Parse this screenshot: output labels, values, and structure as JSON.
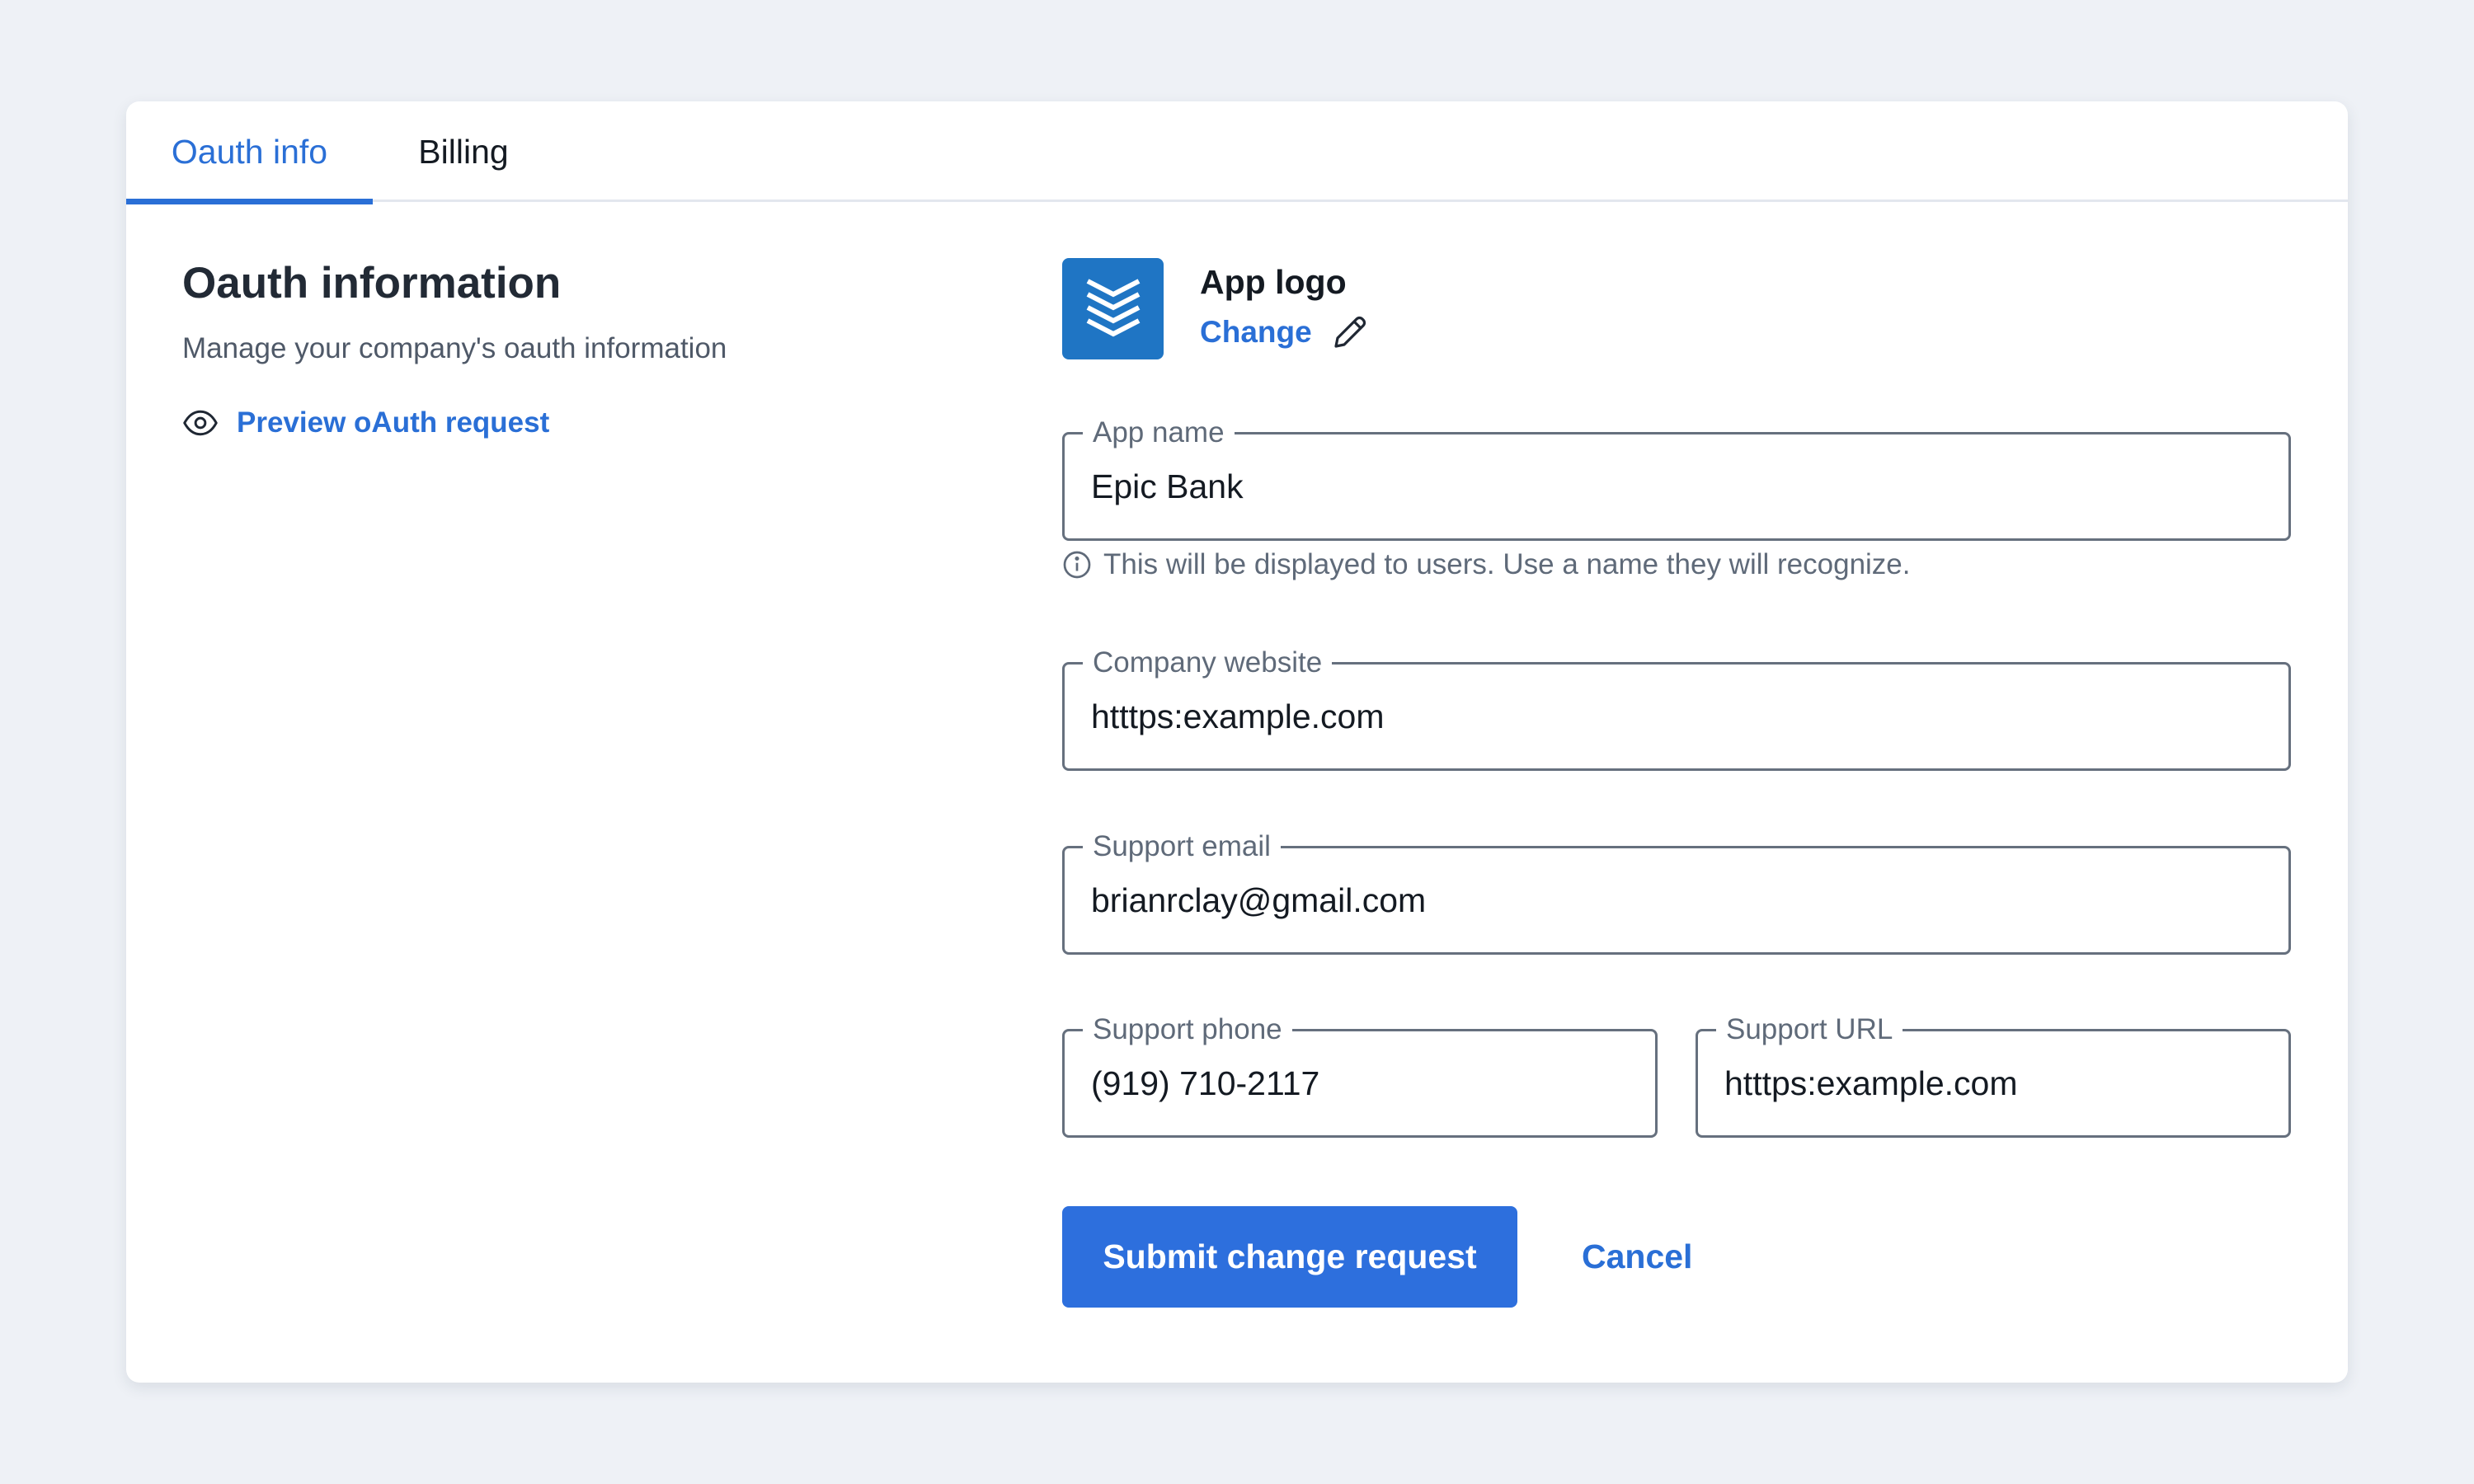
{
  "tabs": [
    {
      "label": "Oauth info",
      "active": true
    },
    {
      "label": "Billing",
      "active": false
    }
  ],
  "section": {
    "title": "Oauth information",
    "description": "Manage your company's oauth information",
    "preview_link": "Preview oAuth request",
    "preview_icon": "eye-icon"
  },
  "app_logo": {
    "label": "App logo",
    "change_label": "Change",
    "change_icon": "pencil-icon",
    "logo_icon": "chevron-stack-logo",
    "logo_color": "#1f75c4"
  },
  "form": {
    "app_name": {
      "label": "App name",
      "value": "Epic Bank",
      "hint": "This will be displayed to users. Use a name they will recognize.",
      "hint_icon": "info-icon"
    },
    "company_website": {
      "label": "Company website",
      "value": "htttps:example.com"
    },
    "support_email": {
      "label": "Support email",
      "value": "brianrclay@gmail.com"
    },
    "support_phone": {
      "label": "Support phone",
      "value": "(919) 710-2117"
    },
    "support_url": {
      "label": "Support URL",
      "value": "htttps:example.com"
    }
  },
  "actions": {
    "submit_label": "Submit change request",
    "cancel_label": "Cancel"
  },
  "colors": {
    "accent": "#2a6fd6",
    "button": "#2d6fdd",
    "background": "#eef1f6"
  }
}
